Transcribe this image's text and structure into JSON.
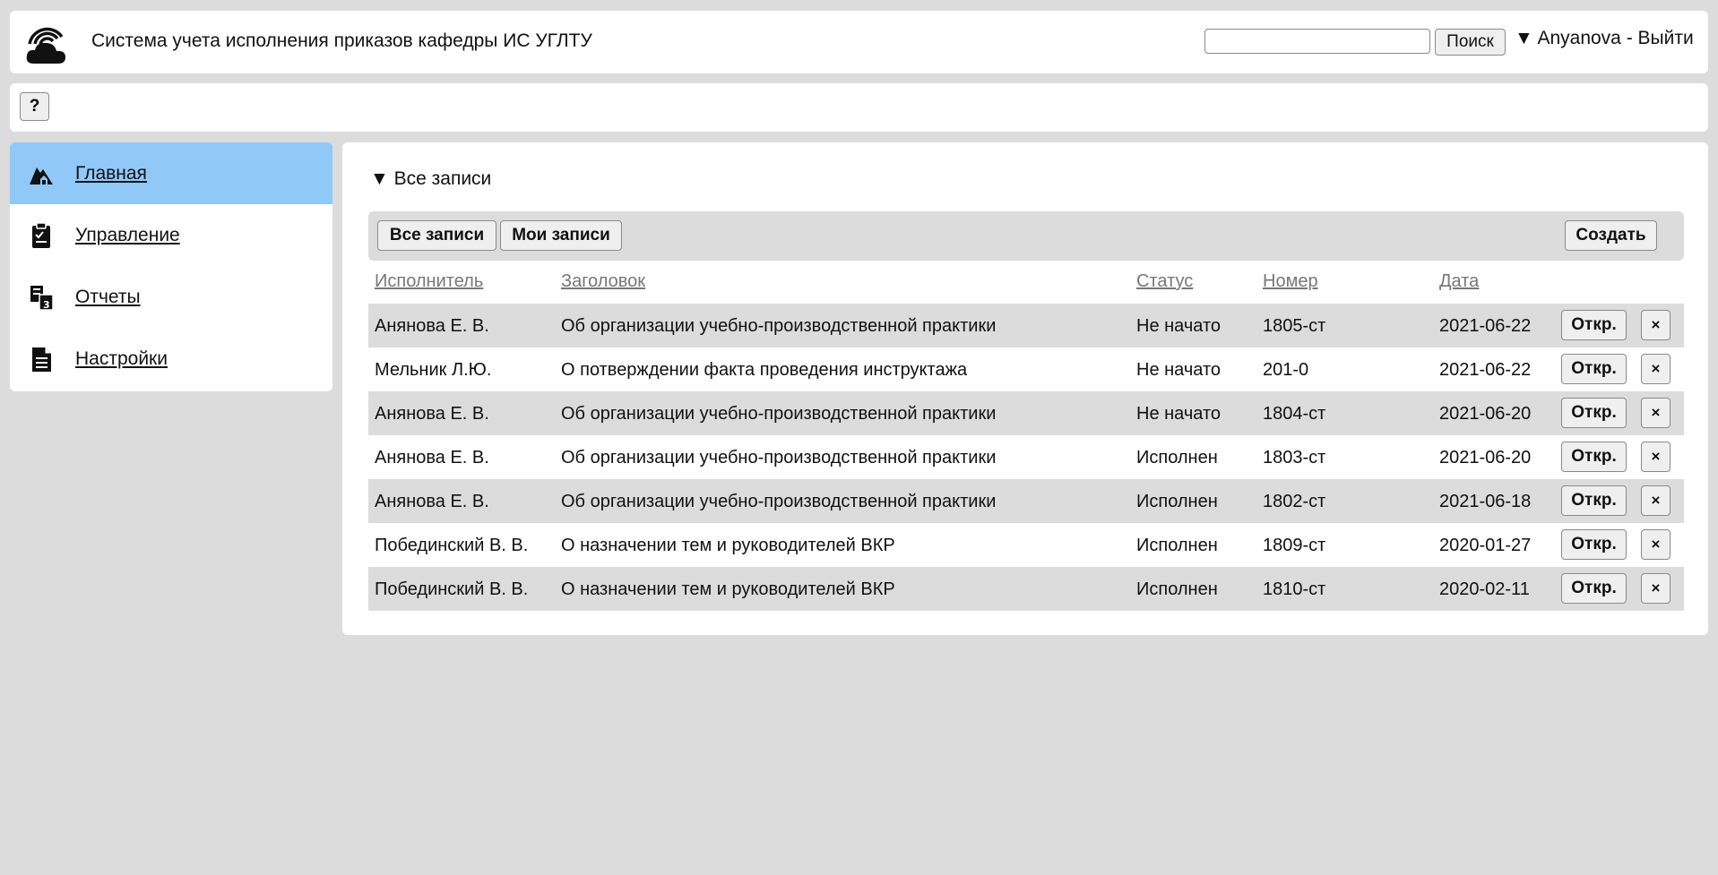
{
  "header": {
    "title": "Система учета исполнения приказов кафедры ИС УГЛТУ",
    "search_value": "",
    "search_button": "Поиск",
    "user_menu": "▼ Anyanova - Выйти",
    "logo_icon": "cloud-logo-icon"
  },
  "toolbar": {
    "help_label": "?"
  },
  "sidebar": {
    "items": [
      {
        "label": "Главная",
        "icon": "home-icon",
        "active": true
      },
      {
        "label": "Управление",
        "icon": "clipboard-icon",
        "active": false
      },
      {
        "label": "Отчеты",
        "icon": "reports-icon",
        "active": false
      },
      {
        "label": "Настройки",
        "icon": "document-icon",
        "active": false
      }
    ],
    "active_color": "#90c8f8"
  },
  "main": {
    "section_title": "▼ Все записи",
    "filters": {
      "all_label": "Все записи",
      "mine_label": "Мои записи",
      "create_label": "Создать"
    },
    "columns": [
      "Исполнитель",
      "Заголовок",
      "Статус",
      "Номер",
      "Дата"
    ],
    "open_label": "Откр.",
    "delete_label": "×",
    "rows": [
      {
        "executor": "Анянова Е. В.",
        "title": "Об организации учебно-производственной практики",
        "status": "Не начато",
        "number": "1805-ст",
        "date": "2021-06-22"
      },
      {
        "executor": "Мельник Л.Ю.",
        "title": "О потверждении факта проведения инструктажа",
        "status": "Не начато",
        "number": "201-0",
        "date": "2021-06-22"
      },
      {
        "executor": "Анянова Е. В.",
        "title": "Об организации учебно-производственной практики",
        "status": "Не начато",
        "number": "1804-ст",
        "date": "2021-06-20"
      },
      {
        "executor": "Анянова Е. В.",
        "title": "Об организации учебно-производственной практики",
        "status": "Исполнен",
        "number": "1803-ст",
        "date": "2021-06-20"
      },
      {
        "executor": "Анянова Е. В.",
        "title": "Об организации учебно-производственной практики",
        "status": "Исполнен",
        "number": "1802-ст",
        "date": "2021-06-18"
      },
      {
        "executor": "Побединский В. В.",
        "title": "О назначении тем и руководителей ВКР",
        "status": "Исполнен",
        "number": "1809-ст",
        "date": "2020-01-27"
      },
      {
        "executor": "Побединский В. В.",
        "title": "О назначении тем и руководителей ВКР",
        "status": "Исполнен",
        "number": "1810-ст",
        "date": "2020-02-11"
      }
    ]
  }
}
